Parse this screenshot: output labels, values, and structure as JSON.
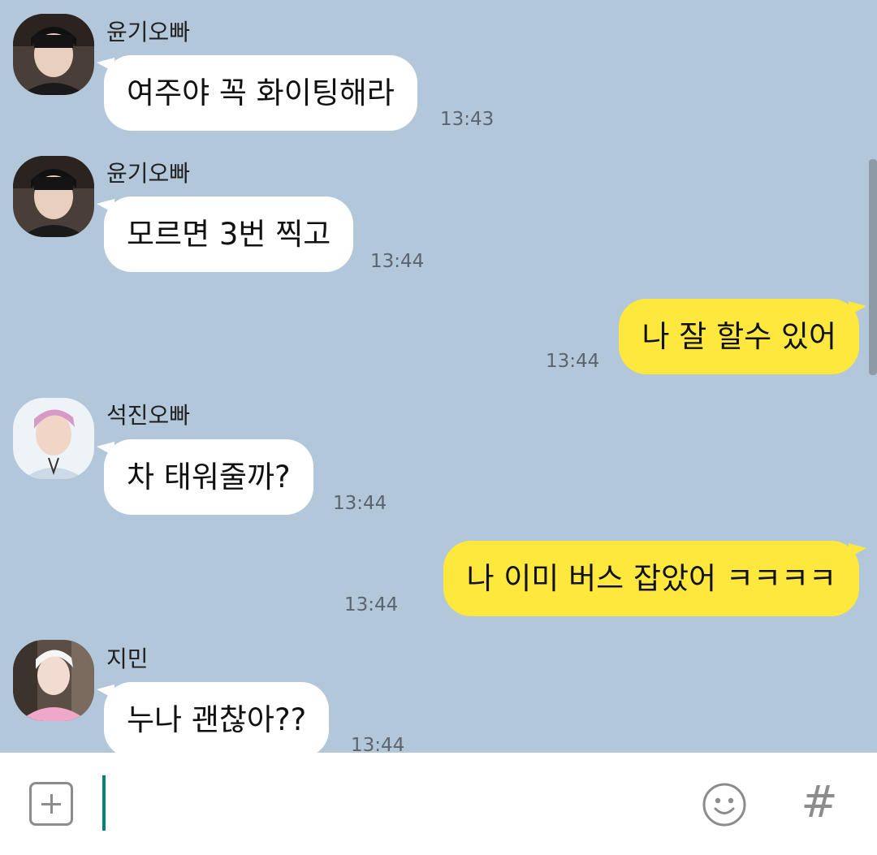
{
  "messages": [
    {
      "sender": "윤기오빠",
      "text": "여주야 꼭 화이팅해라",
      "time": "13:43"
    },
    {
      "sender": "윤기오빠",
      "text": "모르면 3번 찍고",
      "time": "13:44"
    },
    {
      "text": "나 잘 할수 있어",
      "time": "13:44"
    },
    {
      "sender": "석진오빠",
      "text": "차 태워줄까?",
      "time": "13:44"
    },
    {
      "text": "나 이미 버스 잡았어 ㅋㅋㅋㅋ",
      "time": "13:44"
    },
    {
      "sender": "지민",
      "text": "누나 괜찮아??",
      "time": "13:44"
    }
  ],
  "composer": {
    "plus_icon": "plus-square-icon",
    "emoji_icon": "smiley-icon",
    "hash_label": "#"
  },
  "colors": {
    "chat_background": "#b2c7da",
    "outgoing_bubble": "#fee83e",
    "incoming_bubble": "#ffffff",
    "cursor": "#0e7f78"
  }
}
